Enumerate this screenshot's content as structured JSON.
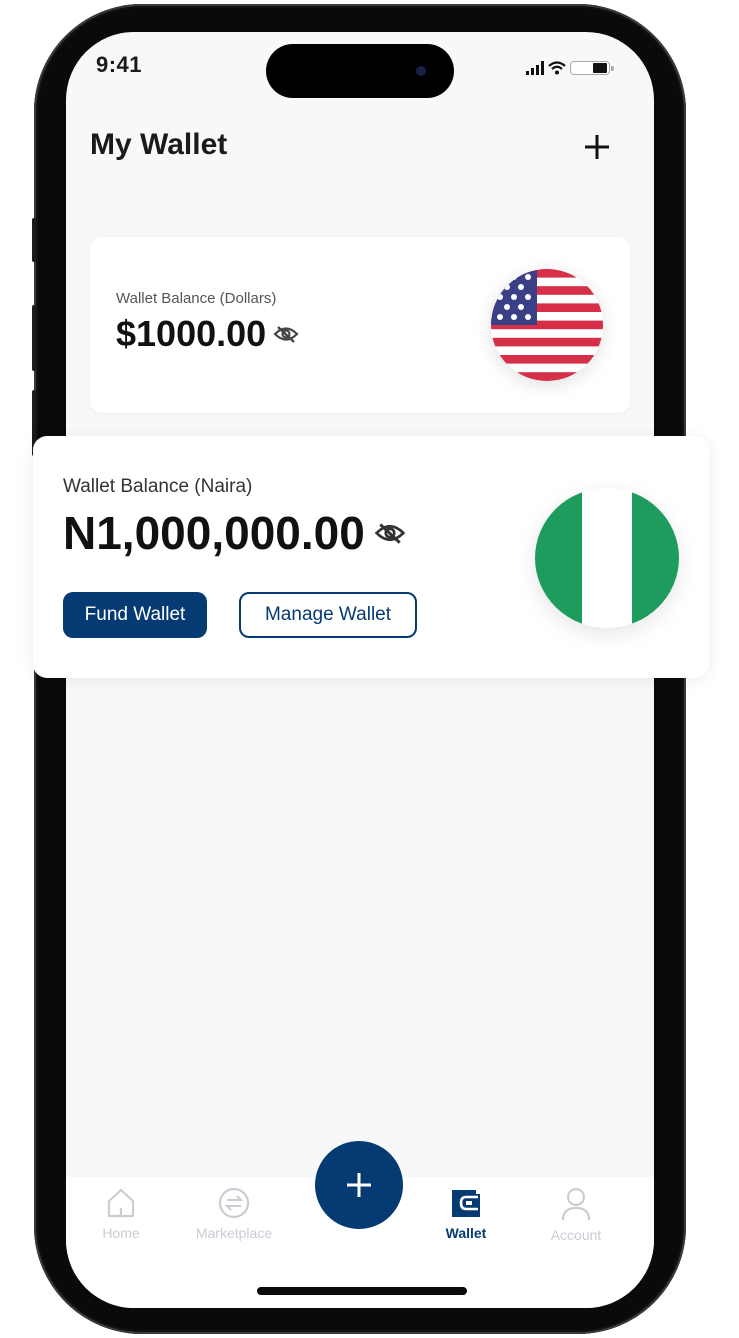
{
  "status_bar": {
    "time": "9:41"
  },
  "header": {
    "title": "My Wallet",
    "add_icon": "plus-icon"
  },
  "wallets": [
    {
      "label": "Wallet Balance (Dollars)",
      "amount": "$1000.00",
      "visibility_icon": "eye-off-icon",
      "flag": "us-flag"
    },
    {
      "label": "Wallet Balance (Naira)",
      "amount": "N1,000,000.00",
      "visibility_icon": "eye-off-icon",
      "flag": "nigeria-flag",
      "actions": {
        "fund": "Fund Wallet",
        "manage": "Manage Wallet"
      }
    }
  ],
  "bottom_nav": {
    "items": [
      {
        "label": "Home",
        "icon": "home-icon",
        "active": false
      },
      {
        "label": "Marketplace",
        "icon": "exchange-icon",
        "active": false
      },
      {
        "label": "Wallet",
        "icon": "wallet-icon",
        "active": true
      },
      {
        "label": "Account",
        "icon": "user-icon",
        "active": false
      }
    ],
    "fab_icon": "plus-icon"
  },
  "colors": {
    "brand": "#063a72",
    "inactive_nav": "#c9cdd4",
    "nigeria_green": "#1e9c5e",
    "us_red": "#d62f47",
    "us_blue": "#3b3f86"
  }
}
